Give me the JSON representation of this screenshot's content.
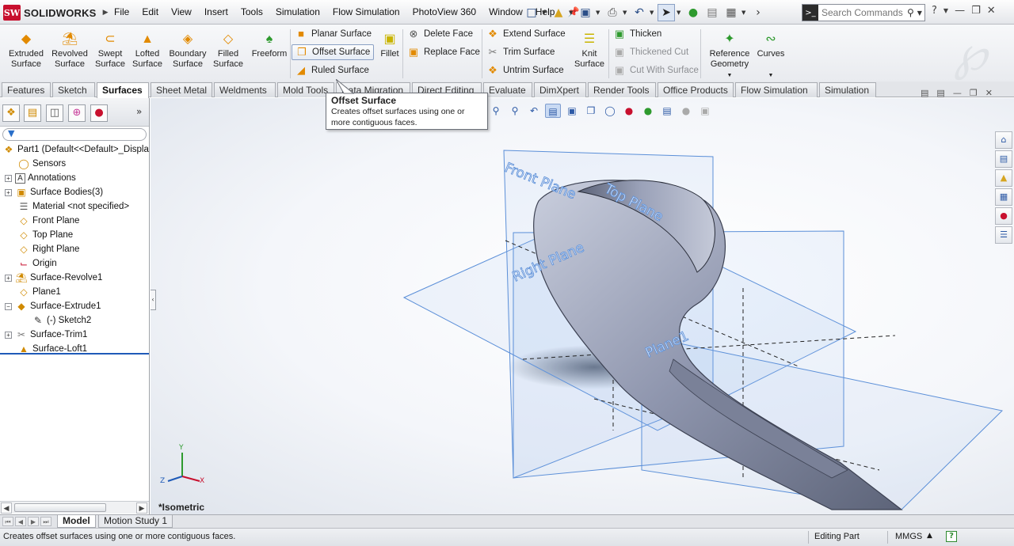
{
  "app": {
    "brand": "SOLIDWORKS",
    "brand_mark": "SW"
  },
  "menu": [
    "File",
    "Edit",
    "View",
    "Insert",
    "Tools",
    "Simulation",
    "Flow Simulation",
    "PhotoView 360",
    "Window",
    "Help"
  ],
  "search": {
    "placeholder": "Search Commands"
  },
  "ribbon": {
    "big": [
      {
        "l1": "Extruded",
        "l2": "Surface"
      },
      {
        "l1": "Revolved",
        "l2": "Surface"
      },
      {
        "l1": "Swept",
        "l2": "Surface"
      },
      {
        "l1": "Lofted",
        "l2": "Surface"
      },
      {
        "l1": "Boundary",
        "l2": "Surface"
      },
      {
        "l1": "Filled",
        "l2": "Surface"
      },
      {
        "l1": "Freeform",
        "l2": ""
      }
    ],
    "planar": "Planar Surface",
    "offset": "Offset Surface",
    "ruled": "Ruled Surface",
    "fillet": "Fillet",
    "delete_face": "Delete Face",
    "replace_face": "Replace Face",
    "extend": "Extend Surface",
    "trim": "Trim Surface",
    "untrim": "Untrim Surface",
    "knit": {
      "l1": "Knit",
      "l2": "Surface"
    },
    "thicken": "Thicken",
    "thickened_cut": "Thickened Cut",
    "cut_with_surface": "Cut With Surface",
    "ref_geom": {
      "l1": "Reference",
      "l2": "Geometry"
    },
    "curves": "Curves"
  },
  "tabs": [
    "Features",
    "Sketch",
    "Surfaces",
    "Sheet Metal",
    "Weldments",
    "Mold Tools",
    "Data Migration",
    "Direct Editing",
    "Evaluate",
    "DimXpert",
    "Render Tools",
    "Office Products",
    "Flow Simulation",
    "Simulation"
  ],
  "active_tab": "Surfaces",
  "tooltip": {
    "title": "Offset Surface",
    "line1": "Creates offset surfaces using one or",
    "line2": "more contiguous faces."
  },
  "tree": {
    "root": "Part1  (Default<<Default>_Displa",
    "items": [
      {
        "label": "Sensors"
      },
      {
        "label": "Annotations"
      },
      {
        "label": "Surface Bodies(3)"
      },
      {
        "label": "Material <not specified>"
      },
      {
        "label": "Front Plane"
      },
      {
        "label": "Top Plane"
      },
      {
        "label": "Right Plane"
      },
      {
        "label": "Origin"
      },
      {
        "label": "Surface-Revolve1"
      },
      {
        "label": "Plane1"
      },
      {
        "label": "Surface-Extrude1"
      },
      {
        "label": "(-) Sketch2"
      },
      {
        "label": "Surface-Trim1"
      },
      {
        "label": "Surface-Loft1"
      }
    ]
  },
  "viewport": {
    "view_name": "*Isometric",
    "plane_labels": {
      "front": "Front Plane",
      "top": "Top Plane",
      "right": "Right Plane",
      "plane1": "Plane1"
    },
    "triad": {
      "x": "X",
      "y": "Y",
      "z": "Z"
    }
  },
  "bottom_tabs": [
    "Model",
    "Motion Study 1"
  ],
  "status": {
    "message": "Creates offset surfaces using one or more contiguous faces.",
    "mode": "Editing Part",
    "units": "MMGS",
    "help": "?"
  },
  "colors": {
    "accent": "#e28a00",
    "plane": "#5b8fd8",
    "body": "#8f96ae",
    "brand": "#c8102e"
  }
}
